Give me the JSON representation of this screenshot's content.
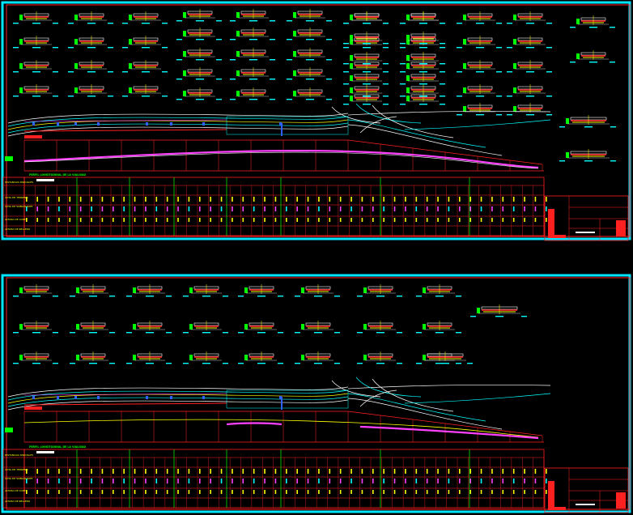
{
  "drawing": {
    "background": "#000000",
    "frame_color": "#00e5ff",
    "line_colors": {
      "cyan": "#00ffff",
      "red": "#ff2020",
      "yellow": "#ffff00",
      "green": "#00ff00",
      "magenta": "#ff40ff",
      "white": "#ffffff",
      "orange": "#ff9900",
      "blue": "#3060ff"
    }
  },
  "sheets": [
    {
      "id": "sheet-top",
      "profile_title": "PERFIL LONGITUDINAL DE LA VIALIDAD",
      "table_row_labels": [
        "DISTANCIAS PARCIALES",
        "COTA DE TERRENO",
        "COTA DE SUBRASANTE",
        "ALTURA DE CORTE",
        "ALTURA DE RELLENO"
      ]
    },
    {
      "id": "sheet-bottom",
      "profile_title": "PERFIL LONGITUDINAL DE LA VIALIDAD",
      "table_row_labels": [
        "DISTANCIAS PARCIALES",
        "COTA DE TERRENO",
        "COTA DE SUBRASANTE",
        "ALTURA DE CORTE",
        "ALTURA DE RELLENO"
      ]
    }
  ]
}
